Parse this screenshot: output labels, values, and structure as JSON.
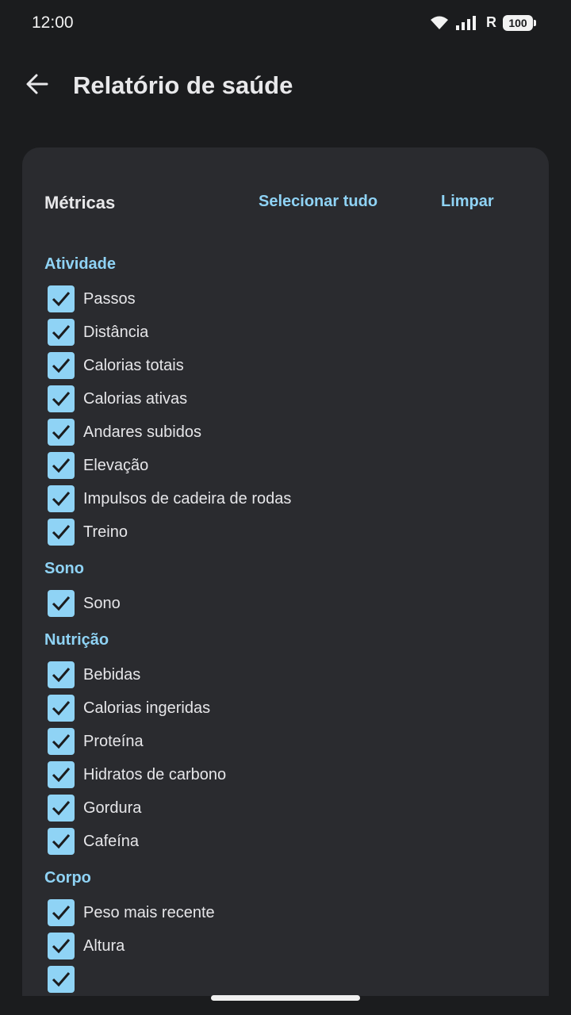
{
  "status_bar": {
    "time": "12:00",
    "network_label": "R",
    "battery": "100"
  },
  "header": {
    "title": "Relatório de saúde"
  },
  "metrics": {
    "title": "Métricas",
    "select_all": "Selecionar tudo",
    "clear": "Limpar"
  },
  "sections": {
    "activity": {
      "title": "Atividade",
      "items": [
        "Passos",
        "Distância",
        "Calorias totais",
        "Calorias ativas",
        "Andares subidos",
        "Elevação",
        "Impulsos de cadeira de rodas",
        "Treino"
      ]
    },
    "sleep": {
      "title": "Sono",
      "items": [
        "Sono"
      ]
    },
    "nutrition": {
      "title": "Nutrição",
      "items": [
        "Bebidas",
        "Calorias ingeridas",
        "Proteína",
        "Hidratos de carbono",
        "Gordura",
        "Cafeína"
      ]
    },
    "body": {
      "title": "Corpo",
      "items": [
        "Peso mais recente",
        "Altura",
        ""
      ]
    }
  },
  "colors": {
    "background": "#1b1c1e",
    "card": "#2a2b2f",
    "accent": "#8fd3f5",
    "text": "#e6e6e9"
  }
}
